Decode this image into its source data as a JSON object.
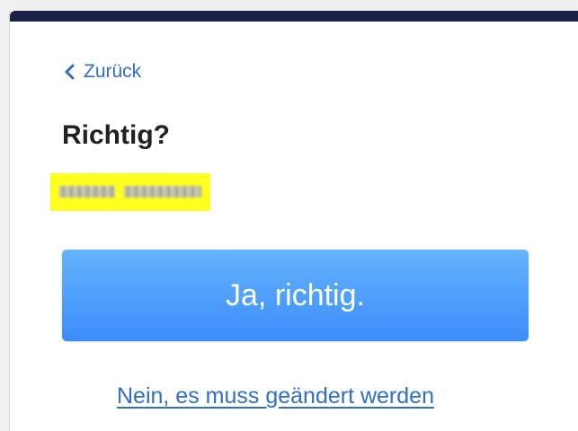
{
  "nav": {
    "back_label": "Zurück"
  },
  "confirm": {
    "heading": "Richtig?",
    "redacted_value_note": "",
    "yes_label": "Ja, richtig.",
    "no_label": "Nein, es muss geändert werden"
  },
  "icons": {
    "back": "chevron-left-icon"
  },
  "colors": {
    "topbar": "#1b2147",
    "link": "#2f6fc8",
    "button_top": "#64b3fc",
    "button_bottom": "#3c8dfb",
    "highlight": "#ffff1f"
  }
}
